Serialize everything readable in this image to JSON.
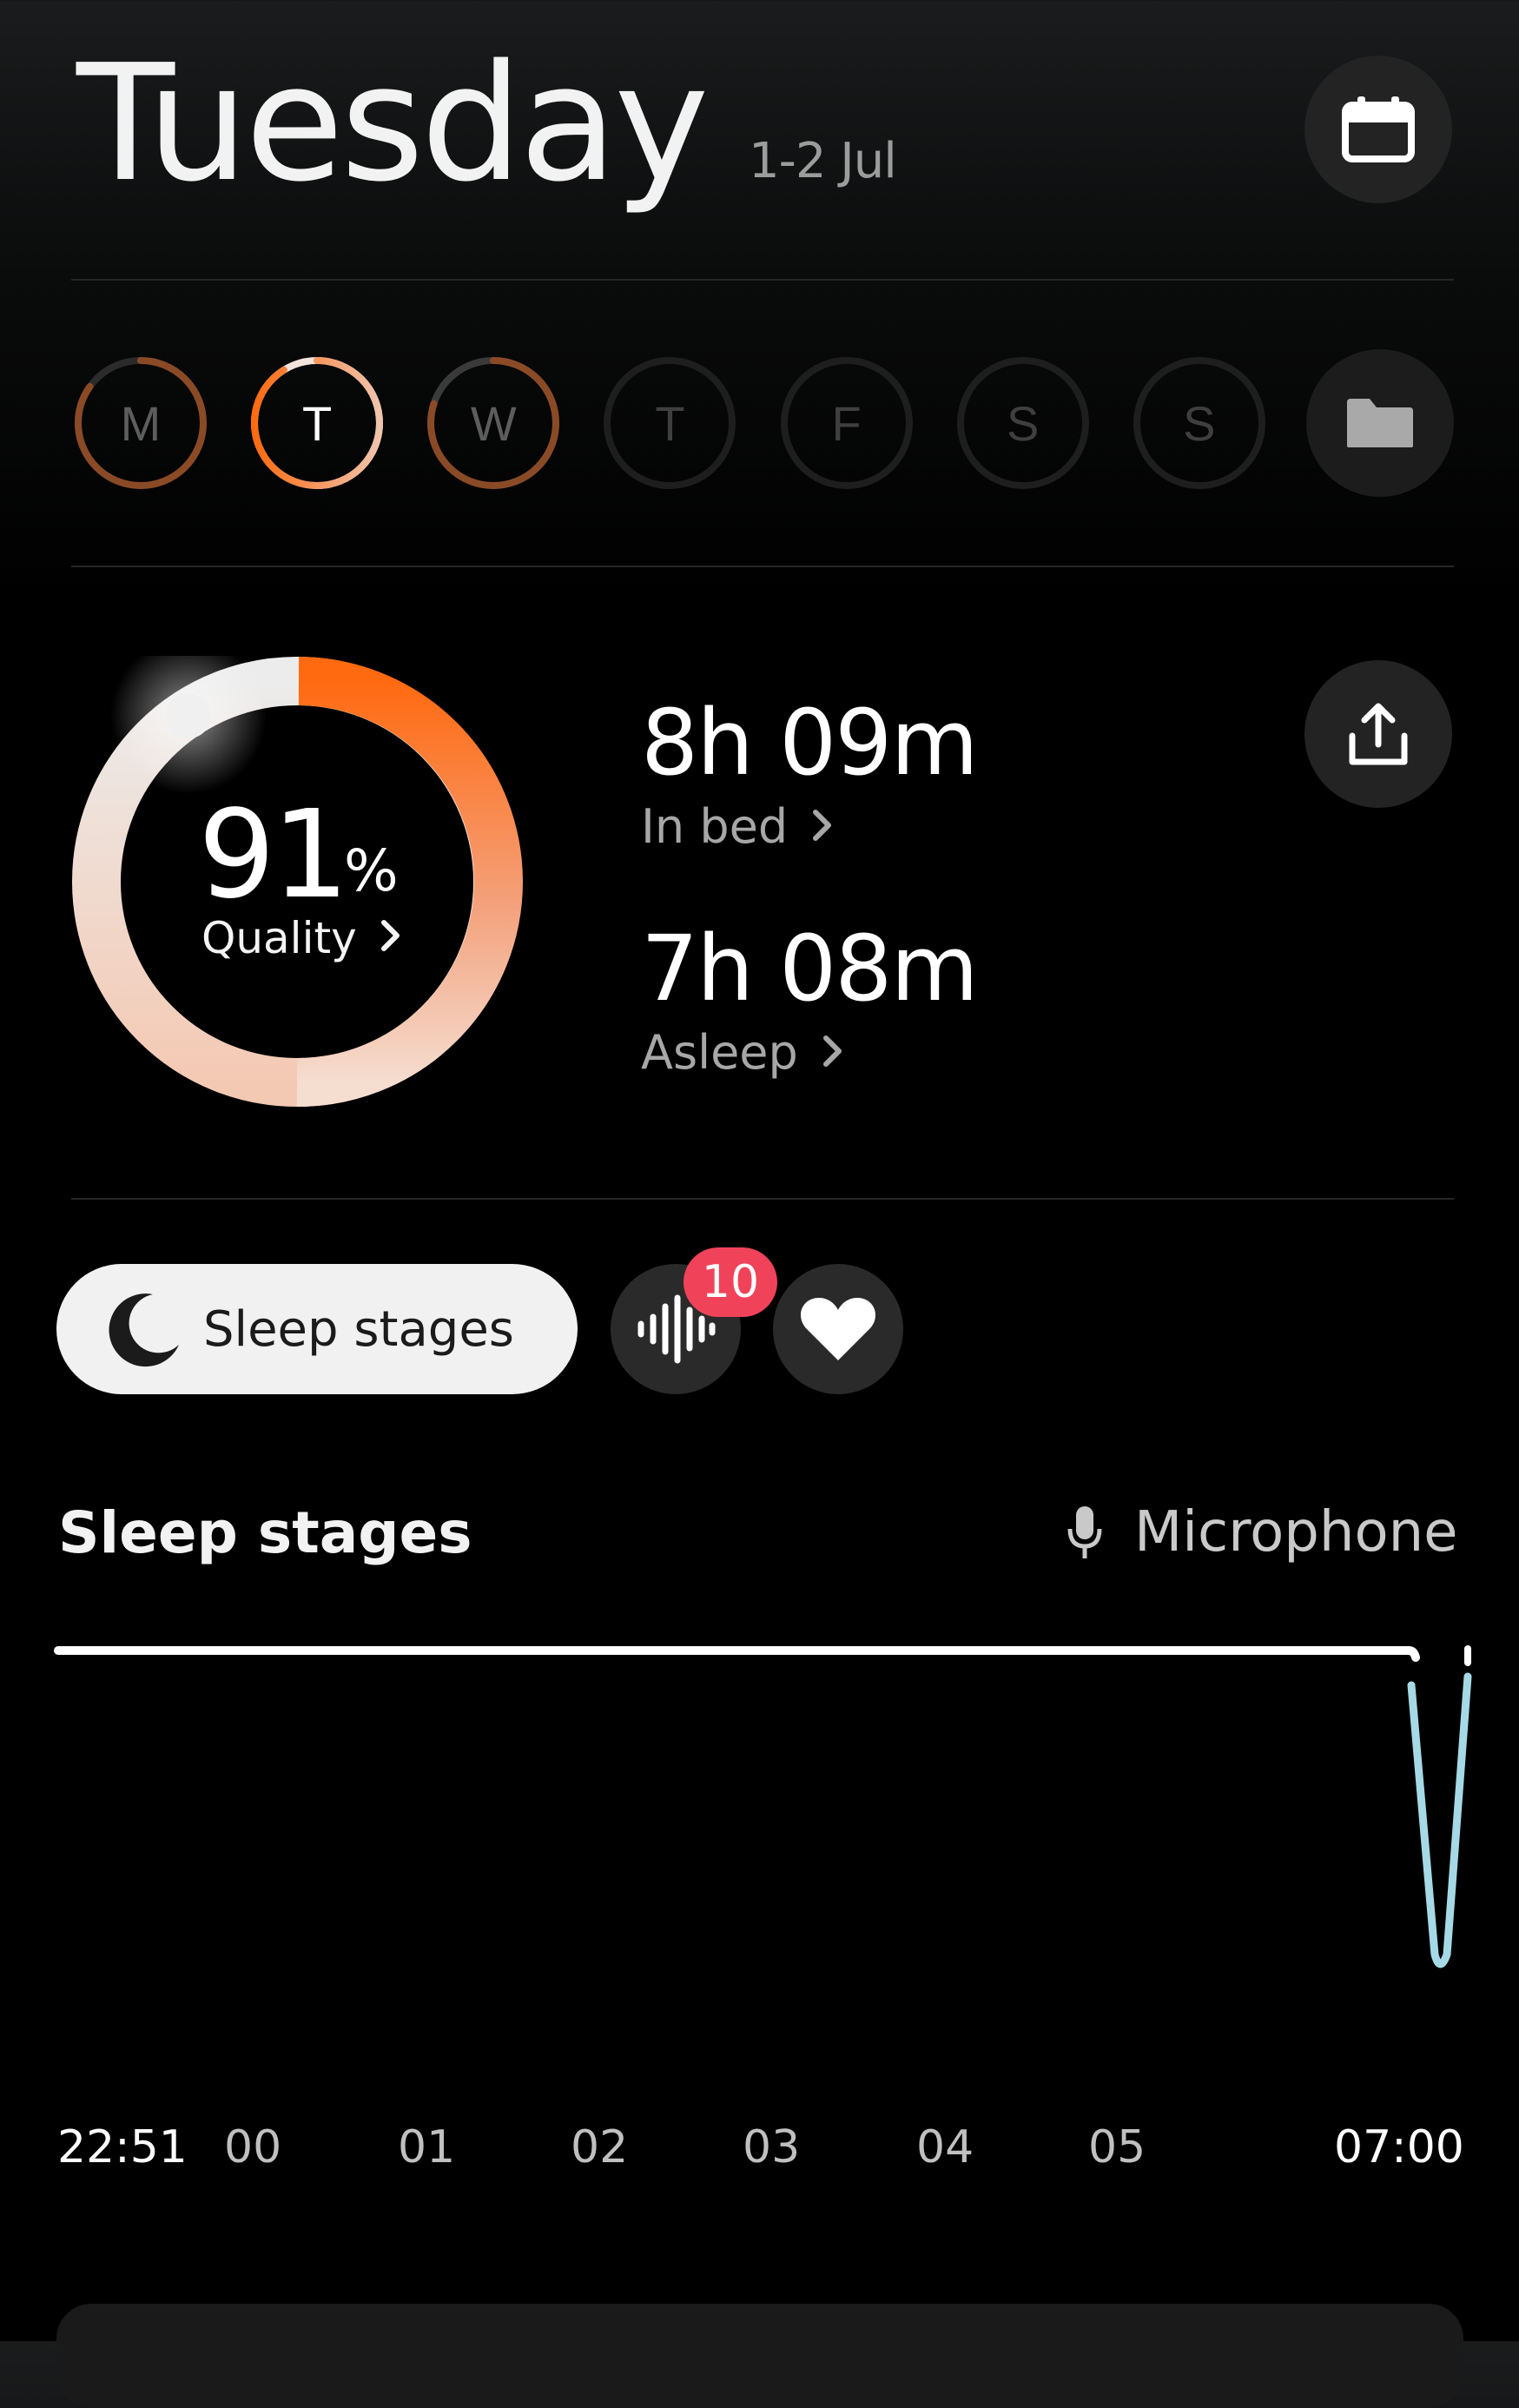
{
  "header": {
    "day": "Tuesday",
    "date_range": "1-2 Jul",
    "calendar_icon": "calendar-icon"
  },
  "week": {
    "days": [
      {
        "letter": "M",
        "state": "past",
        "progress": 0.85
      },
      {
        "letter": "T",
        "state": "selected",
        "progress": 0.91
      },
      {
        "letter": "W",
        "state": "past",
        "progress": 0.8
      },
      {
        "letter": "T",
        "state": "future",
        "progress": 0
      },
      {
        "letter": "F",
        "state": "future",
        "progress": 0
      },
      {
        "letter": "S",
        "state": "future",
        "progress": 0
      },
      {
        "letter": "S",
        "state": "future",
        "progress": 0
      }
    ],
    "folder_icon": "folder-icon"
  },
  "summary": {
    "quality_value": "91",
    "quality_unit": "%",
    "quality_label": "Quality",
    "quality_fraction": 0.91,
    "in_bed_value": "8h 09m",
    "in_bed_label": "In bed",
    "asleep_value": "7h 08m",
    "asleep_label": "Asleep",
    "share_icon": "share-icon"
  },
  "filters": {
    "sleep_stages_label": "Sleep stages",
    "sounds_badge": "10",
    "sounds_icon": "waveform-icon",
    "heart_icon": "heart-icon"
  },
  "sleep_stages": {
    "title": "Sleep stages",
    "source_label": "Microphone",
    "axis_labels": [
      "22:51",
      "00",
      "01",
      "02",
      "03",
      "04",
      "05",
      "07:00"
    ]
  },
  "colors": {
    "accent_orange": "#ff6a10",
    "ring_light": "#f3e6df",
    "stage_line": "#ffffff",
    "stage_dip": "#a6d9e6",
    "badge_red": "#f0435a"
  }
}
